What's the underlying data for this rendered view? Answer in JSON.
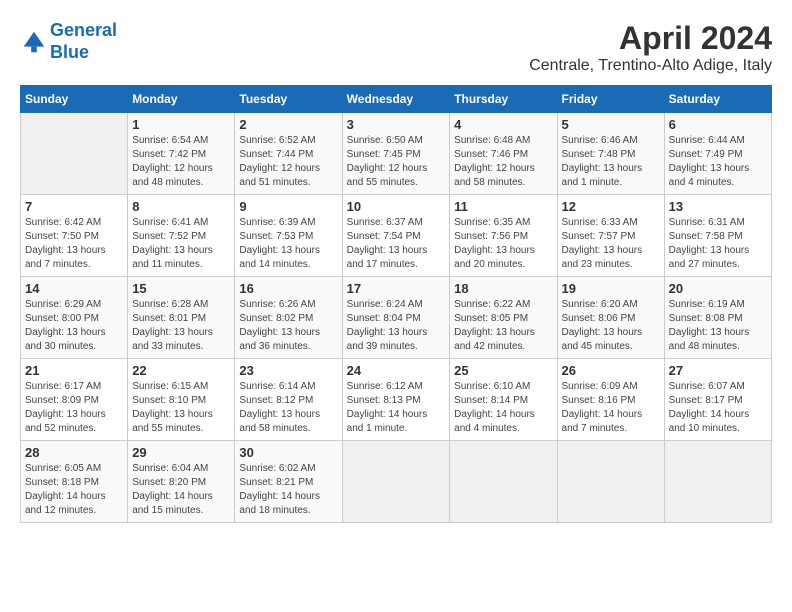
{
  "app": {
    "logo_line1": "General",
    "logo_line2": "Blue"
  },
  "title": "April 2024",
  "subtitle": "Centrale, Trentino-Alto Adige, Italy",
  "header_days": [
    "Sunday",
    "Monday",
    "Tuesday",
    "Wednesday",
    "Thursday",
    "Friday",
    "Saturday"
  ],
  "weeks": [
    [
      {
        "num": "",
        "info": ""
      },
      {
        "num": "1",
        "info": "Sunrise: 6:54 AM\nSunset: 7:42 PM\nDaylight: 12 hours\nand 48 minutes."
      },
      {
        "num": "2",
        "info": "Sunrise: 6:52 AM\nSunset: 7:44 PM\nDaylight: 12 hours\nand 51 minutes."
      },
      {
        "num": "3",
        "info": "Sunrise: 6:50 AM\nSunset: 7:45 PM\nDaylight: 12 hours\nand 55 minutes."
      },
      {
        "num": "4",
        "info": "Sunrise: 6:48 AM\nSunset: 7:46 PM\nDaylight: 12 hours\nand 58 minutes."
      },
      {
        "num": "5",
        "info": "Sunrise: 6:46 AM\nSunset: 7:48 PM\nDaylight: 13 hours\nand 1 minute."
      },
      {
        "num": "6",
        "info": "Sunrise: 6:44 AM\nSunset: 7:49 PM\nDaylight: 13 hours\nand 4 minutes."
      }
    ],
    [
      {
        "num": "7",
        "info": "Sunrise: 6:42 AM\nSunset: 7:50 PM\nDaylight: 13 hours\nand 7 minutes."
      },
      {
        "num": "8",
        "info": "Sunrise: 6:41 AM\nSunset: 7:52 PM\nDaylight: 13 hours\nand 11 minutes."
      },
      {
        "num": "9",
        "info": "Sunrise: 6:39 AM\nSunset: 7:53 PM\nDaylight: 13 hours\nand 14 minutes."
      },
      {
        "num": "10",
        "info": "Sunrise: 6:37 AM\nSunset: 7:54 PM\nDaylight: 13 hours\nand 17 minutes."
      },
      {
        "num": "11",
        "info": "Sunrise: 6:35 AM\nSunset: 7:56 PM\nDaylight: 13 hours\nand 20 minutes."
      },
      {
        "num": "12",
        "info": "Sunrise: 6:33 AM\nSunset: 7:57 PM\nDaylight: 13 hours\nand 23 minutes."
      },
      {
        "num": "13",
        "info": "Sunrise: 6:31 AM\nSunset: 7:58 PM\nDaylight: 13 hours\nand 27 minutes."
      }
    ],
    [
      {
        "num": "14",
        "info": "Sunrise: 6:29 AM\nSunset: 8:00 PM\nDaylight: 13 hours\nand 30 minutes."
      },
      {
        "num": "15",
        "info": "Sunrise: 6:28 AM\nSunset: 8:01 PM\nDaylight: 13 hours\nand 33 minutes."
      },
      {
        "num": "16",
        "info": "Sunrise: 6:26 AM\nSunset: 8:02 PM\nDaylight: 13 hours\nand 36 minutes."
      },
      {
        "num": "17",
        "info": "Sunrise: 6:24 AM\nSunset: 8:04 PM\nDaylight: 13 hours\nand 39 minutes."
      },
      {
        "num": "18",
        "info": "Sunrise: 6:22 AM\nSunset: 8:05 PM\nDaylight: 13 hours\nand 42 minutes."
      },
      {
        "num": "19",
        "info": "Sunrise: 6:20 AM\nSunset: 8:06 PM\nDaylight: 13 hours\nand 45 minutes."
      },
      {
        "num": "20",
        "info": "Sunrise: 6:19 AM\nSunset: 8:08 PM\nDaylight: 13 hours\nand 48 minutes."
      }
    ],
    [
      {
        "num": "21",
        "info": "Sunrise: 6:17 AM\nSunset: 8:09 PM\nDaylight: 13 hours\nand 52 minutes."
      },
      {
        "num": "22",
        "info": "Sunrise: 6:15 AM\nSunset: 8:10 PM\nDaylight: 13 hours\nand 55 minutes."
      },
      {
        "num": "23",
        "info": "Sunrise: 6:14 AM\nSunset: 8:12 PM\nDaylight: 13 hours\nand 58 minutes."
      },
      {
        "num": "24",
        "info": "Sunrise: 6:12 AM\nSunset: 8:13 PM\nDaylight: 14 hours\nand 1 minute."
      },
      {
        "num": "25",
        "info": "Sunrise: 6:10 AM\nSunset: 8:14 PM\nDaylight: 14 hours\nand 4 minutes."
      },
      {
        "num": "26",
        "info": "Sunrise: 6:09 AM\nSunset: 8:16 PM\nDaylight: 14 hours\nand 7 minutes."
      },
      {
        "num": "27",
        "info": "Sunrise: 6:07 AM\nSunset: 8:17 PM\nDaylight: 14 hours\nand 10 minutes."
      }
    ],
    [
      {
        "num": "28",
        "info": "Sunrise: 6:05 AM\nSunset: 8:18 PM\nDaylight: 14 hours\nand 12 minutes."
      },
      {
        "num": "29",
        "info": "Sunrise: 6:04 AM\nSunset: 8:20 PM\nDaylight: 14 hours\nand 15 minutes."
      },
      {
        "num": "30",
        "info": "Sunrise: 6:02 AM\nSunset: 8:21 PM\nDaylight: 14 hours\nand 18 minutes."
      },
      {
        "num": "",
        "info": ""
      },
      {
        "num": "",
        "info": ""
      },
      {
        "num": "",
        "info": ""
      },
      {
        "num": "",
        "info": ""
      }
    ]
  ]
}
